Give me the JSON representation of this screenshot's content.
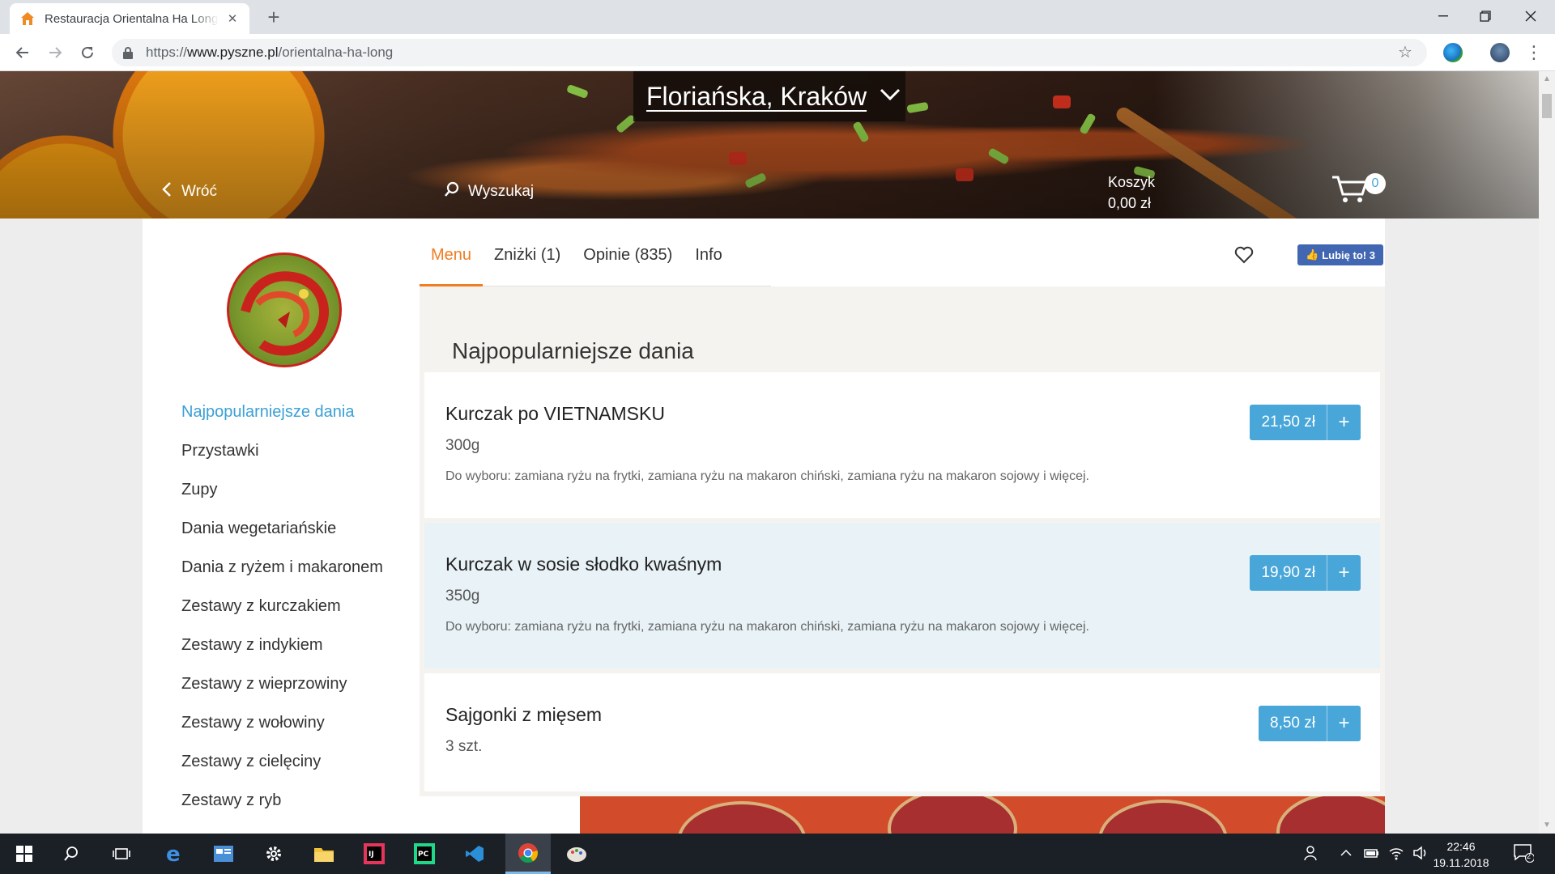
{
  "browser": {
    "tab_title": "Restauracja Orientalna Ha Long K",
    "url_scheme": "https://",
    "url_host": "www.pyszne.pl",
    "url_path": "/orientalna-ha-long"
  },
  "hero": {
    "location": "Floriańska, Kraków",
    "back_label": "Wróć",
    "search_label": "Wyszukaj",
    "cart_label": "Koszyk",
    "cart_total": "0,00 zł",
    "cart_count": "0"
  },
  "sidebar": {
    "categories": [
      {
        "label": "Najpopularniejsze dania",
        "active": true
      },
      {
        "label": "Przystawki"
      },
      {
        "label": "Zupy"
      },
      {
        "label": "Dania wegetariańskie"
      },
      {
        "label": "Dania z ryżem i makaronem"
      },
      {
        "label": "Zestawy z kurczakiem"
      },
      {
        "label": "Zestawy z indykiem"
      },
      {
        "label": "Zestawy z wieprzowiny"
      },
      {
        "label": "Zestawy z wołowiny"
      },
      {
        "label": "Zestawy z cielęciny"
      },
      {
        "label": "Zestawy z ryb"
      }
    ]
  },
  "tabs": [
    {
      "label": "Menu",
      "active": true
    },
    {
      "label": "Zniżki (1)"
    },
    {
      "label": "Opinie (835)"
    },
    {
      "label": "Info"
    }
  ],
  "fb_like": "Lubię to! 3",
  "section_title": "Najpopularniejsze dania",
  "dishes": [
    {
      "name": "Kurczak po VIETNAMSKU",
      "size": "300g",
      "desc": "Do wyboru: zamiana ryżu na frytki, zamiana ryżu na makaron chiński, zamiana ryżu na makaron sojowy i więcej.",
      "price": "21,50 zł"
    },
    {
      "name": "Kurczak w sosie słodko kwaśnym",
      "size": "350g",
      "desc": "Do wyboru: zamiana ryżu na frytki, zamiana ryżu na makaron chiński, zamiana ryżu na makaron sojowy i więcej.",
      "price": "19,90 zł"
    },
    {
      "name": "Sajgonki z mięsem",
      "size": "3 szt.",
      "desc": "",
      "price": "8,50 zł"
    }
  ],
  "taskbar": {
    "time": "22:46",
    "date": "19.11.2018",
    "notifications": "2"
  },
  "colors": {
    "accent_orange": "#ef7d22",
    "accent_blue": "#48a6d9",
    "active_category": "#3ba0d6"
  },
  "icons": [
    "home-icon",
    "close-icon",
    "plus-icon",
    "back-arrow-icon",
    "forward-arrow-icon",
    "reload-icon",
    "lock-icon",
    "star-icon",
    "chevron-down-icon",
    "chevron-left-icon",
    "search-icon",
    "cart-icon",
    "heart-icon",
    "windows-start-icon"
  ]
}
